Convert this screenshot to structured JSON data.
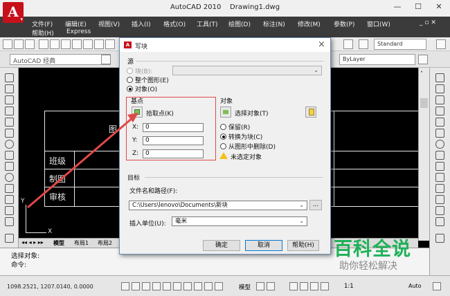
{
  "window": {
    "app_title": "AutoCAD 2010",
    "doc_title": "Drawing1.dwg",
    "minimize_glyph": "—",
    "maximize_glyph": "☐",
    "close_glyph": "✕"
  },
  "menu": {
    "row1": [
      "文件(F)",
      "编辑(E)",
      "视图(V)",
      "插入(I)",
      "格式(O)",
      "工具(T)",
      "绘图(D)",
      "标注(N)",
      "修改(M)",
      "参数(P)",
      "窗口(W)"
    ],
    "row2": [
      "帮助(H)",
      "Express"
    ],
    "doc_controls": "_ ▫ ✕"
  },
  "toolbar": {
    "workspace": "AutoCAD 经典",
    "text_style": "Standard",
    "layer_box": "ByLayer"
  },
  "drawing": {
    "labels": [
      "班级",
      "制图",
      "审核"
    ],
    "partial_label": "图",
    "axis_y": "Y",
    "axis_x": "X"
  },
  "tabs": {
    "nav": "◂◂ ◂ ▸ ▸▸",
    "model": "模型",
    "layout1": "布局1",
    "layout2": "布局2"
  },
  "command": {
    "line1": "选择对象:",
    "line2": "命令:"
  },
  "status": {
    "coords": "1098.2521, 1207.0140, 0.0000",
    "model": "模型",
    "scale": "1:1",
    "auto": "Auto"
  },
  "dialog": {
    "title": "写块",
    "close_glyph": "×",
    "source": {
      "heading": "源",
      "block_label": "块(B):",
      "whole_drawing_label": "整个图形(E)",
      "objects_label": "对象(O)"
    },
    "base_point": {
      "heading": "基点",
      "pick_label": "拾取点(K)",
      "x_label": "X:",
      "y_label": "Y:",
      "z_label": "Z:",
      "x_value": "0",
      "y_value": "0",
      "z_value": "0"
    },
    "objects": {
      "heading": "对象",
      "select_label": "选择对象(T)",
      "retain_label": "保留(R)",
      "convert_label": "转换为块(C)",
      "delete_label": "从图形中删除(D)",
      "warning_label": "未选定对象"
    },
    "target": {
      "heading": "目标",
      "path_label": "文件名和路径(F):",
      "path_value": "C:\\Users\\lenovo\\Documents\\新块",
      "browse_label": "...",
      "units_label": "插入单位(U):",
      "units_value": "毫米"
    },
    "buttons": {
      "ok": "确定",
      "cancel": "取消",
      "help": "帮助(H)"
    }
  },
  "watermark": {
    "title": "百科全说",
    "subtitle": "助你轻松解决"
  }
}
